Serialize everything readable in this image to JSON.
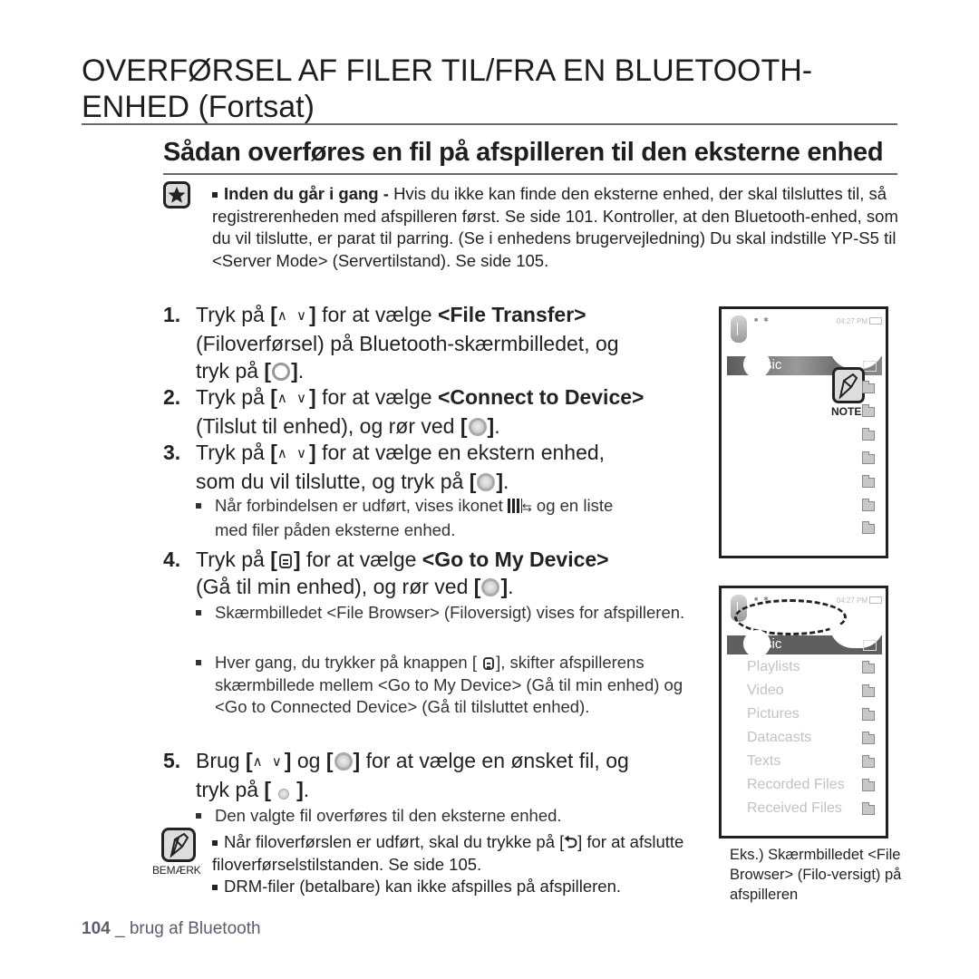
{
  "page": {
    "title_line1": "OVERFØRSEL AF FILER TIL/FRA EN BLUETOOTH-",
    "title_line2": "ENHED (Fortsat)",
    "subtitle": "Sådan overføres en fil på afspilleren til den eksterne enhed"
  },
  "intro_note": {
    "icon": "star-icon",
    "bold_lead": "Inden du går i gang - ",
    "text": "Hvis du ikke kan finde den eksterne enhed, der skal tilsluttes til, så registrerenheden med afspilleren først. Se side 101. Kontroller, at den Bluetooth-enhed, som du vil tilslutte, er parat til parring. (Se i enhedens brugervejledning) Du skal indstille YP-S5 til <Server Mode> (Servertilstand). Se side 105."
  },
  "keys": {
    "up_down": "∧ ∨",
    "open_bracket": "[",
    "close_bracket": "]"
  },
  "steps": [
    {
      "num": "1.",
      "pre": "Tryk på ",
      "mid": " for at vælge ",
      "bold": "<File Transfer>",
      "line2": "(Filoverførsel) på Bluetooth-skærmbilledet, og",
      "line3_pre": "tryk på ",
      "end": "."
    },
    {
      "num": "2.",
      "pre": "Tryk på ",
      "mid": " for at vælge ",
      "bold": "<Connect to Device>",
      "line2_pre": "(Tilslut til enhed), og rør ved ",
      "end": "."
    },
    {
      "num": "3.",
      "pre": "Tryk på ",
      "mid": " for at vælge en ekstern enhed,",
      "line2_pre": "som du vil tilslutte, og tryk på ",
      "end": ".",
      "bullets": [
        {
          "pre": "Når forbindelsen er udført, vises ikonet ",
          "icon": "connected-device-icon",
          "post": " og en liste",
          "line2": "med filer påden eksterne enhed."
        }
      ]
    },
    {
      "num": "4.",
      "pre": "Tryk på ",
      "mid": " for at vælge ",
      "bold": "<Go to My Device>",
      "line2_pre": "(Gå til min enhed), og rør ved ",
      "end": ".",
      "bullets": [
        {
          "text": "Skærmbilledet <File Browser> (Filoversigt) vises for afspilleren."
        },
        {
          "pre": "Hver gang, du trykker på knappen [ ",
          "post": "], skifter afspillerens skærmbillede mellem <Go to My Device> (Gå til min enhed) og <Go to Connected Device> (Gå til tilsluttet enhed)."
        }
      ]
    },
    {
      "num": "5.",
      "pre": "Brug ",
      "mid1": " og ",
      "mid2": " for at vælge en ønsket fil, og",
      "line2_pre": "tryk på ",
      "end": ".",
      "bullets": [
        {
          "text": "Den valgte fil overføres til den eksterne enhed."
        }
      ]
    }
  ],
  "bemaerk": {
    "label": "BEMÆRK",
    "note1_pre": "Når filoverførslen er udført, skal du trykke på [",
    "back_symbol": "⮌",
    "note1_post": "] for at afslutte filoverførselstilstanden. Se side 105.",
    "note2": "DRM-filer (betalbare) kan ikke afspilles på afspilleren."
  },
  "screens": [
    {
      "time": "04:27 PM",
      "header": "sic",
      "overlay_label": "NOTE",
      "folder_count": 7
    },
    {
      "time": "04:27 PM",
      "header": "sic",
      "items": [
        "Playlists",
        "Video",
        "Pictures",
        "Datacasts",
        "Texts",
        "Recorded Files",
        "Received Files"
      ]
    }
  ],
  "caption": "Eks.) Skærmbilledet <File Browser> (Filo-versigt) på afspilleren",
  "footer": {
    "page_number": "104",
    "separator": " _ ",
    "section": "brug af Bluetooth"
  }
}
